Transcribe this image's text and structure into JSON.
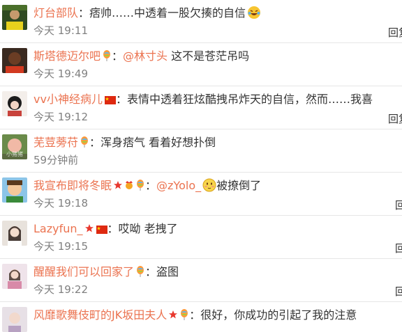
{
  "comments": [
    {
      "user": "灯台部队",
      "text": "痞帅……中透着一股欠揍的自信",
      "time": "今天 19:11",
      "reply": "回复",
      "emoji": "laughing-tears-emoji"
    },
    {
      "user": "斯塔德迈尔吧",
      "mention": "@林寸头",
      "text": " 这不是苍茫吊吗",
      "time": "今天 19:49",
      "badge": "balloon-badge"
    },
    {
      "user": "vv小神经病儿",
      "text": "表情中透着狂炫酷拽吊炸天的自信，然而……我喜",
      "time": "今天 19:12",
      "reply": "回复",
      "badge": "china-flag-badge"
    },
    {
      "user": "芜荳蒡苻",
      "text": "浑身痞气 看着好想扑倒",
      "time": "59分钟前",
      "badge": "balloon-badge",
      "avatar_hint": "小猪猪"
    },
    {
      "user": "我宣布即将冬眠",
      "mention": "@zYolo_",
      "text": "被撩倒了",
      "time": "今天 19:18",
      "reply": "回",
      "emoji": "blushing-face-emoji"
    },
    {
      "user": "Lazyfun_",
      "text": "哎呦 老拽了",
      "time": "今天 19:15",
      "reply": "回"
    },
    {
      "user": "醒醒我们可以回家了",
      "text": "盗图",
      "time": "今天 19:22",
      "reply": "回"
    },
    {
      "user": "风靡歌舞伎町的JK坂田夫人",
      "text": "很好，你成功的引起了我的注意"
    }
  ],
  "colors": {
    "username": "#eb7350",
    "text": "#333333",
    "time": "#808080",
    "divider": "#e6e6e6",
    "background": "#ffffff"
  }
}
